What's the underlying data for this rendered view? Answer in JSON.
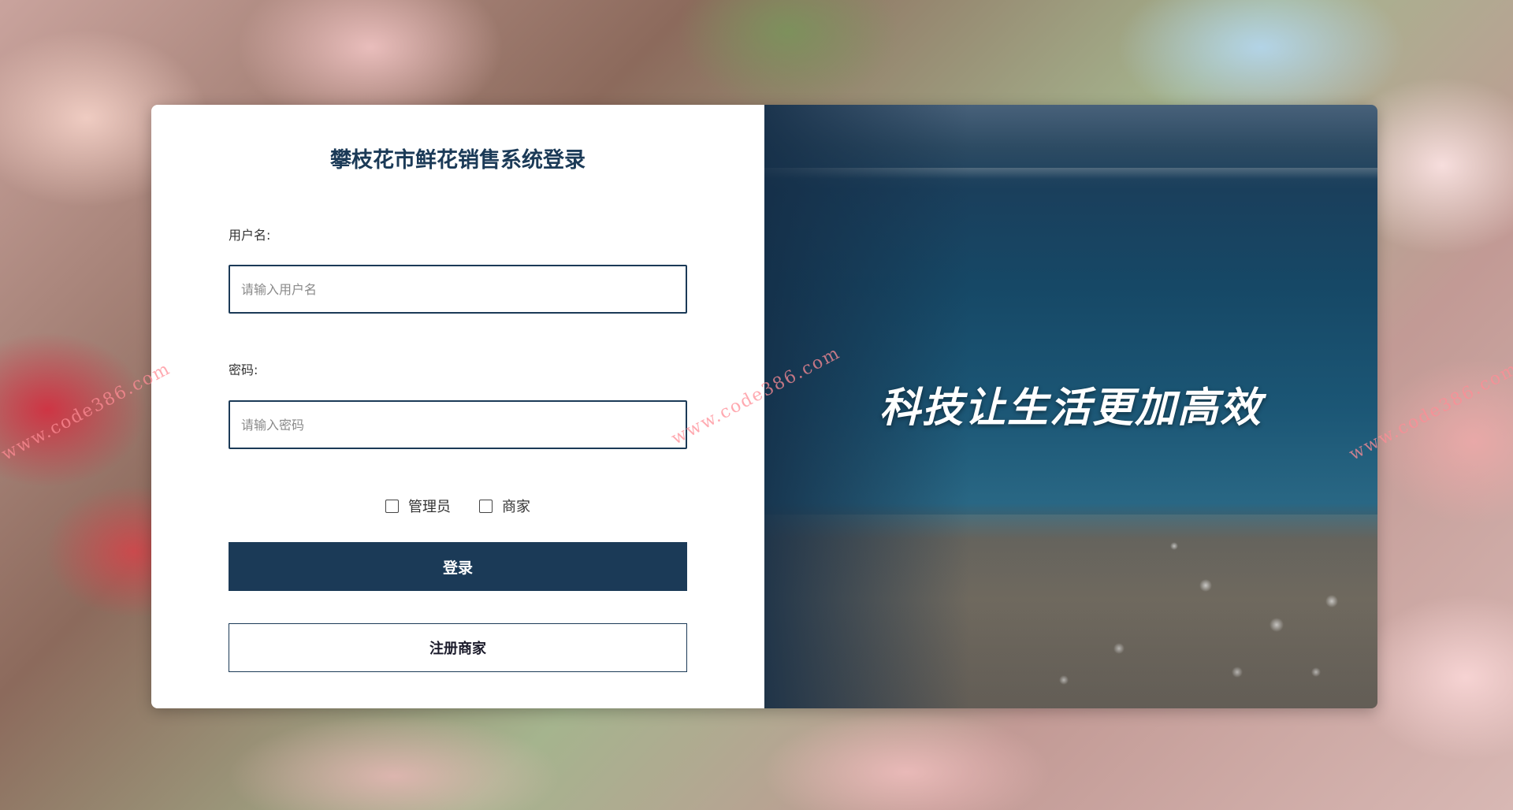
{
  "login": {
    "title": "攀枝花市鲜花销售系统登录",
    "username_label": "用户名:",
    "username_placeholder": "请输入用户名",
    "password_label": "密码:",
    "password_placeholder": "请输入密码",
    "roles": [
      {
        "label": "管理员",
        "checked": false
      },
      {
        "label": "商家",
        "checked": false
      }
    ],
    "login_button": "登录",
    "register_button": "注册商家"
  },
  "banner": {
    "slogan": "科技让生活更加高效"
  },
  "watermark_text": "www.code386.com",
  "colors": {
    "primary": "#1b3a57",
    "text": "#333333",
    "card_bg": "#ffffff"
  },
  "icons": {
    "checkbox": "checkbox-icon"
  }
}
